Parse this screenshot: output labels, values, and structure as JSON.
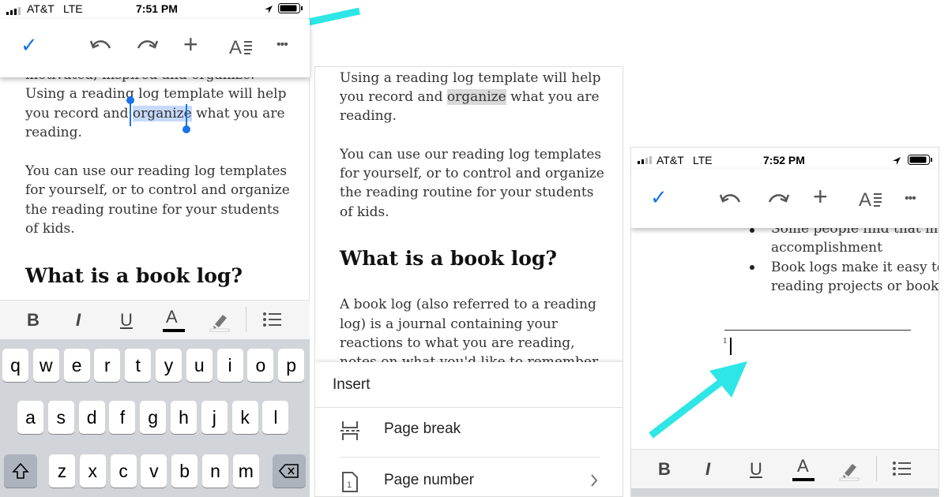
{
  "left_phone": {
    "status": {
      "carrier": "AT&T",
      "network": "LTE",
      "time": "7:51 PM"
    },
    "toolbar": {
      "check": "✓",
      "undo": "undo-icon",
      "redo": "redo-icon",
      "insert": "+",
      "format": "format-text-icon",
      "more": "•••"
    },
    "doc": {
      "line0": "motivated, inspired and organize.",
      "line1": "Using a reading log template will help",
      "line2_pre": "you record and ",
      "line2_sel": "organize",
      "line2_post": " what you are",
      "line3": "reading.",
      "p2_l1": "You can use our reading log templates",
      "p2_l2": "for yourself, or to control and organize",
      "p2_l3": "the reading routine for your students",
      "p2_l4": "of kids.",
      "heading": "What is a book log?"
    },
    "format_bar": {
      "bold": "B",
      "italic": "I",
      "underline": "U",
      "text_color": "A"
    },
    "keyboard": {
      "row1": [
        "q",
        "w",
        "e",
        "r",
        "t",
        "y",
        "u",
        "i",
        "o",
        "p"
      ],
      "row2": [
        "a",
        "s",
        "d",
        "f",
        "g",
        "h",
        "j",
        "k",
        "l"
      ],
      "row3": [
        "z",
        "x",
        "c",
        "v",
        "b",
        "n",
        "m"
      ]
    }
  },
  "middle_panel": {
    "doc": {
      "l1": "Using a reading log template will help",
      "l2_pre": "you record and ",
      "l2_sel": "organize",
      "l2_post": " what you are",
      "l3": "reading.",
      "p2_l1": "You can use our reading log templates",
      "p2_l2": "for yourself, or to control and organize",
      "p2_l3": "the reading routine for your students",
      "p2_l4": "of kids.",
      "heading": "What is a book log?",
      "p3_l1": "A book log (also referred to a reading",
      "p3_l2": "log) is a journal containing your",
      "p3_l3": "reactions to what you are reading,",
      "p3_l4": "notes on what you'd like to remember"
    },
    "insert_menu": {
      "title": "Insert",
      "items": [
        {
          "label": "Page break",
          "icon": "page-break-icon"
        },
        {
          "label": "Page number",
          "icon": "page-number-icon"
        }
      ]
    }
  },
  "right_phone": {
    "status": {
      "carrier": "AT&T",
      "network": "LTE",
      "time": "7:52 PM"
    },
    "doc": {
      "b1_l1": "Some people find that ma",
      "b1_l2": "accomplishment",
      "b2_l1": "Book logs make it easy to",
      "b2_l2": "reading projects or book c",
      "footnote_num": "1"
    },
    "format_bar": {
      "bold": "B",
      "italic": "I",
      "underline": "U",
      "text_color": "A"
    }
  },
  "colors": {
    "accent": "#1a73e8",
    "arrow": "#2ee6e6",
    "selection": "#c6dafc",
    "gray_selection": "#d9d9d9"
  }
}
